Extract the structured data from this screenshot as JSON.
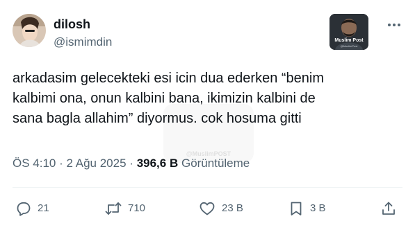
{
  "user": {
    "display_name": "dilosh",
    "handle": "@ismimdin"
  },
  "brand": {
    "label": "Muslim Post",
    "sub": "@MuslimPost"
  },
  "watermark": {
    "text": "@MuslimPOST"
  },
  "tweet": {
    "text": "arkadasim gelecekteki esi icin dua ederken “benim\nkalbimi ona, onun kalbini bana, ikimizin kalbini de\nsana bagla allahim” diyormus. cok hosuma gitti"
  },
  "meta": {
    "time": "ÖS 4:10",
    "separator": "·",
    "date": "2 Ağu 2025",
    "views_count": "396,6 B",
    "views_label": "Görüntüleme"
  },
  "actions": {
    "reply_count": "21",
    "retweet_count": "710",
    "like_count": "23 B",
    "bookmark_count": "3 B"
  },
  "icons": {
    "more": "more-dots-icon",
    "reply": "reply-bubble-icon",
    "retweet": "retweet-icon",
    "like": "heart-icon",
    "bookmark": "bookmark-icon",
    "share": "share-upload-icon"
  },
  "colors": {
    "text": "#0f1419",
    "secondary": "#536471",
    "divider": "#eff3f4"
  }
}
